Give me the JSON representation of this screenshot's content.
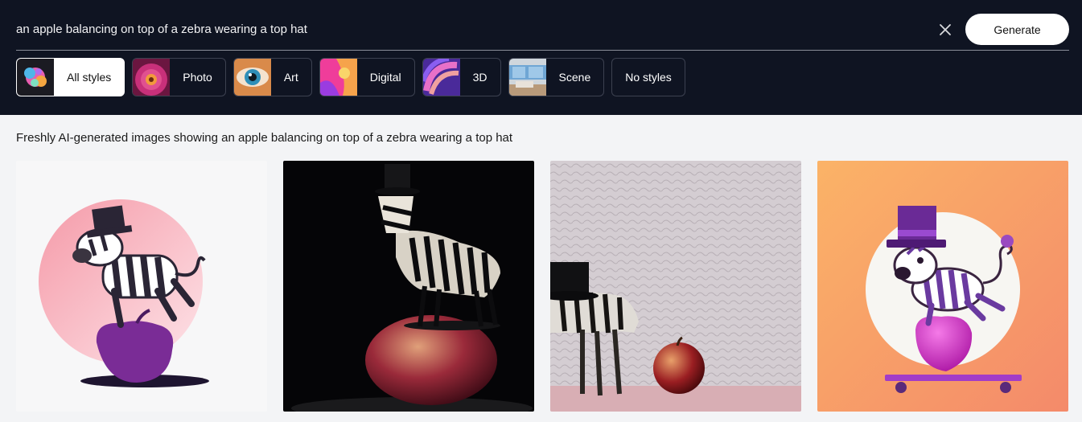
{
  "search": {
    "prompt": "an apple balancing on top of a zebra wearing a top hat",
    "generate_label": "Generate"
  },
  "styles": [
    {
      "label": "All styles",
      "active": true,
      "icon": "paint-splash-thumbnail"
    },
    {
      "label": "Photo",
      "active": false,
      "icon": "flower-thumbnail"
    },
    {
      "label": "Art",
      "active": false,
      "icon": "eye-thumbnail"
    },
    {
      "label": "Digital",
      "active": false,
      "icon": "digital-art-thumbnail"
    },
    {
      "label": "3D",
      "active": false,
      "icon": "swirl-3d-thumbnail"
    },
    {
      "label": "Scene",
      "active": false,
      "icon": "room-scene-thumbnail"
    },
    {
      "label": "No styles",
      "active": false
    }
  ],
  "results": {
    "caption": "Freshly AI-generated images showing an apple balancing on top of a zebra wearing a top hat",
    "images": [
      {
        "name": "illustrated-zebra-on-purple-apple"
      },
      {
        "name": "photo-zebra-figurine-on-red-apple"
      },
      {
        "name": "photo-zebra-with-hat-beside-apple"
      },
      {
        "name": "cartoon-zebra-on-pink-apple-skateboard"
      }
    ]
  },
  "colors": {
    "header_bg": "#0f1422",
    "page_bg": "#f3f4f6",
    "chip_border": "#3c4150"
  }
}
